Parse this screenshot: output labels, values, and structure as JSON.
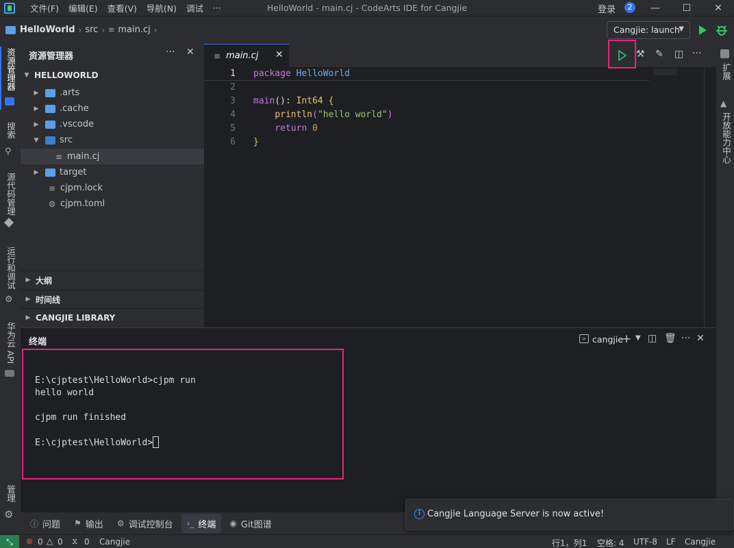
{
  "titlebar": {
    "menu": [
      "文件(F)",
      "编辑(E)",
      "查看(V)",
      "导航(N)",
      "调试",
      "···"
    ],
    "window_title": "HelloWorld - main.cj - CodeArts IDE for Cangjie",
    "login_label": "登录",
    "notification_count": "2"
  },
  "breadcrumb": {
    "project": "HelloWorld",
    "folder": "src",
    "file": "main.cj"
  },
  "run_config": {
    "selected": "Cangjie: launch"
  },
  "activity_bar": {
    "explorer": "资源管理器",
    "search": "搜索",
    "scm": "源代码管理",
    "run_debug": "运行和调试",
    "huawei_api": "华为云 API",
    "manage": "管理"
  },
  "right_bar": {
    "extensions": "扩展",
    "open_center": "开放能力中心"
  },
  "explorer": {
    "title": "资源管理器",
    "root": "HELLOWORLD",
    "items": [
      {
        "label": ".arts",
        "type": "folder"
      },
      {
        "label": ".cache",
        "type": "folder"
      },
      {
        "label": ".vscode",
        "type": "folder"
      },
      {
        "label": "src",
        "type": "folder-open"
      },
      {
        "label": "main.cj",
        "type": "file"
      },
      {
        "label": "target",
        "type": "folder"
      },
      {
        "label": "cjpm.lock",
        "type": "file"
      },
      {
        "label": "cjpm.toml",
        "type": "gear-file"
      }
    ],
    "sections": [
      "大纲",
      "时间线",
      "CANGJIE LIBRARY"
    ]
  },
  "editor": {
    "tab_label": "main.cj",
    "line_numbers": [
      "1",
      "2",
      "3",
      "4",
      "5",
      "6"
    ],
    "code": {
      "l1_kw": "package",
      "l1_name": "HelloWorld",
      "l3_fn": "main",
      "l3_paren": "(): ",
      "l3_type": "Int64",
      "l3_brace": " {",
      "l4_call": "println",
      "l4_open": "(",
      "l4_str": "\"hello world\"",
      "l4_close": ")",
      "l5_kw": "return",
      "l5_num": "0",
      "l6_brace": "}"
    }
  },
  "panel": {
    "title": "终端",
    "terminal_name": "cangjie",
    "lines": [
      "E:\\cjptest\\HelloWorld>cjpm run",
      "hello world",
      "",
      "cjpm run finished",
      "",
      "E:\\cjptest\\HelloWorld>"
    ]
  },
  "toolstrip": {
    "problems": "问题",
    "output": "输出",
    "debug_console": "调试控制台",
    "terminal": "终端",
    "git_graph": "Git图谱"
  },
  "statusbar": {
    "errors": "0",
    "warnings": "0",
    "ports": "0",
    "language_mode_left": "Cangjie",
    "cursor_pos": "行1，列1",
    "indent": "空格: 4",
    "encoding": "UTF-8",
    "eol": "LF",
    "language": "Cangjie"
  },
  "toast": {
    "message": "Cangjie Language Server is now active!"
  },
  "colors": {
    "accent": "#3574f0",
    "highlight_box": "#e8267c",
    "run_green": "#35c46b"
  }
}
